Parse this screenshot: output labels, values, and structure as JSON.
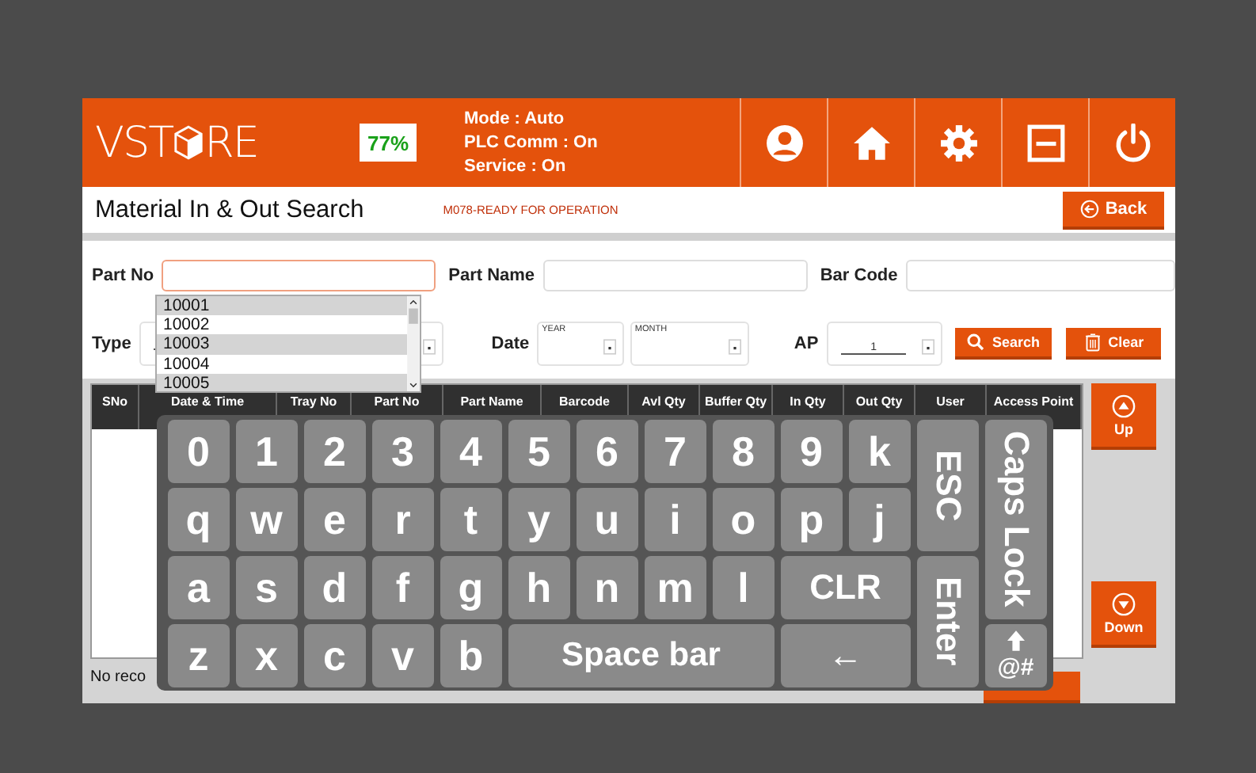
{
  "header": {
    "logo": {
      "before": "VST",
      "after": "RE"
    },
    "gauge": "77%",
    "status": [
      "Mode : Auto",
      "PLC Comm : On",
      "Service : On"
    ]
  },
  "title_bar": {
    "title": "Material In & Out Search",
    "message": "M078-READY FOR OPERATION",
    "back": "Back"
  },
  "form": {
    "part_no": {
      "label": "Part No",
      "focused": true
    },
    "part_name": {
      "label": "Part Name"
    },
    "bar_code": {
      "label": "Bar Code"
    },
    "type": {
      "label": "Type"
    },
    "date": {
      "label": "Date",
      "year": "YEAR",
      "month": "MONTH"
    },
    "ap": {
      "label": "AP",
      "value": "1"
    },
    "search": "Search",
    "clear": "Clear",
    "suggestions": [
      {
        "text": "10001",
        "shaded": true
      },
      {
        "text": "10002",
        "shaded": false
      },
      {
        "text": "10003",
        "shaded": true
      },
      {
        "text": "10004",
        "shaded": false
      },
      {
        "text": "10005",
        "shaded": true
      }
    ]
  },
  "table": {
    "columns": [
      "SNo",
      "Date & Time",
      "Tray No",
      "Part No",
      "Part Name",
      "Barcode",
      "Avl Qty",
      "Buffer Qty",
      "In Qty",
      "Out Qty",
      "User",
      "Access Point"
    ],
    "status": "No reco"
  },
  "side_buttons": {
    "up": "Up",
    "down": "Down"
  },
  "keyboard": [
    {
      "label": "0",
      "kind": "key"
    },
    {
      "label": "1",
      "kind": "key"
    },
    {
      "label": "2",
      "kind": "key"
    },
    {
      "label": "3",
      "kind": "key"
    },
    {
      "label": "4",
      "kind": "key"
    },
    {
      "label": "5",
      "kind": "key"
    },
    {
      "label": "6",
      "kind": "key"
    },
    {
      "label": "7",
      "kind": "key"
    },
    {
      "label": "8",
      "kind": "key"
    },
    {
      "label": "9",
      "kind": "key"
    },
    {
      "label": "k",
      "kind": "key"
    },
    {
      "label": "ESC",
      "kind": "tall"
    },
    {
      "label": "Caps Lock",
      "kind": "taller"
    },
    {
      "label": "q",
      "kind": "key"
    },
    {
      "label": "w",
      "kind": "key"
    },
    {
      "label": "e",
      "kind": "key"
    },
    {
      "label": "r",
      "kind": "key"
    },
    {
      "label": "t",
      "kind": "key"
    },
    {
      "label": "y",
      "kind": "key"
    },
    {
      "label": "u",
      "kind": "key"
    },
    {
      "label": "i",
      "kind": "key"
    },
    {
      "label": "o",
      "kind": "key"
    },
    {
      "label": "p",
      "kind": "key"
    },
    {
      "label": "j",
      "kind": "key"
    },
    {
      "label": "a",
      "kind": "key"
    },
    {
      "label": "s",
      "kind": "key"
    },
    {
      "label": "d",
      "kind": "key"
    },
    {
      "label": "f",
      "kind": "key"
    },
    {
      "label": "g",
      "kind": "key"
    },
    {
      "label": "h",
      "kind": "key"
    },
    {
      "label": "n",
      "kind": "key"
    },
    {
      "label": "m",
      "kind": "key"
    },
    {
      "label": "l",
      "kind": "key"
    },
    {
      "label": "CLR",
      "kind": "wide"
    },
    {
      "label": "Enter",
      "kind": "tall"
    },
    {
      "label": "z",
      "kind": "key"
    },
    {
      "label": "x",
      "kind": "key"
    },
    {
      "label": "c",
      "kind": "key"
    },
    {
      "label": "v",
      "kind": "key"
    },
    {
      "label": "b",
      "kind": "key"
    },
    {
      "label": "Space bar",
      "kind": "space"
    },
    {
      "label": "←",
      "kind": "wide"
    },
    {
      "label": "@#",
      "kind": "symbols"
    }
  ]
}
